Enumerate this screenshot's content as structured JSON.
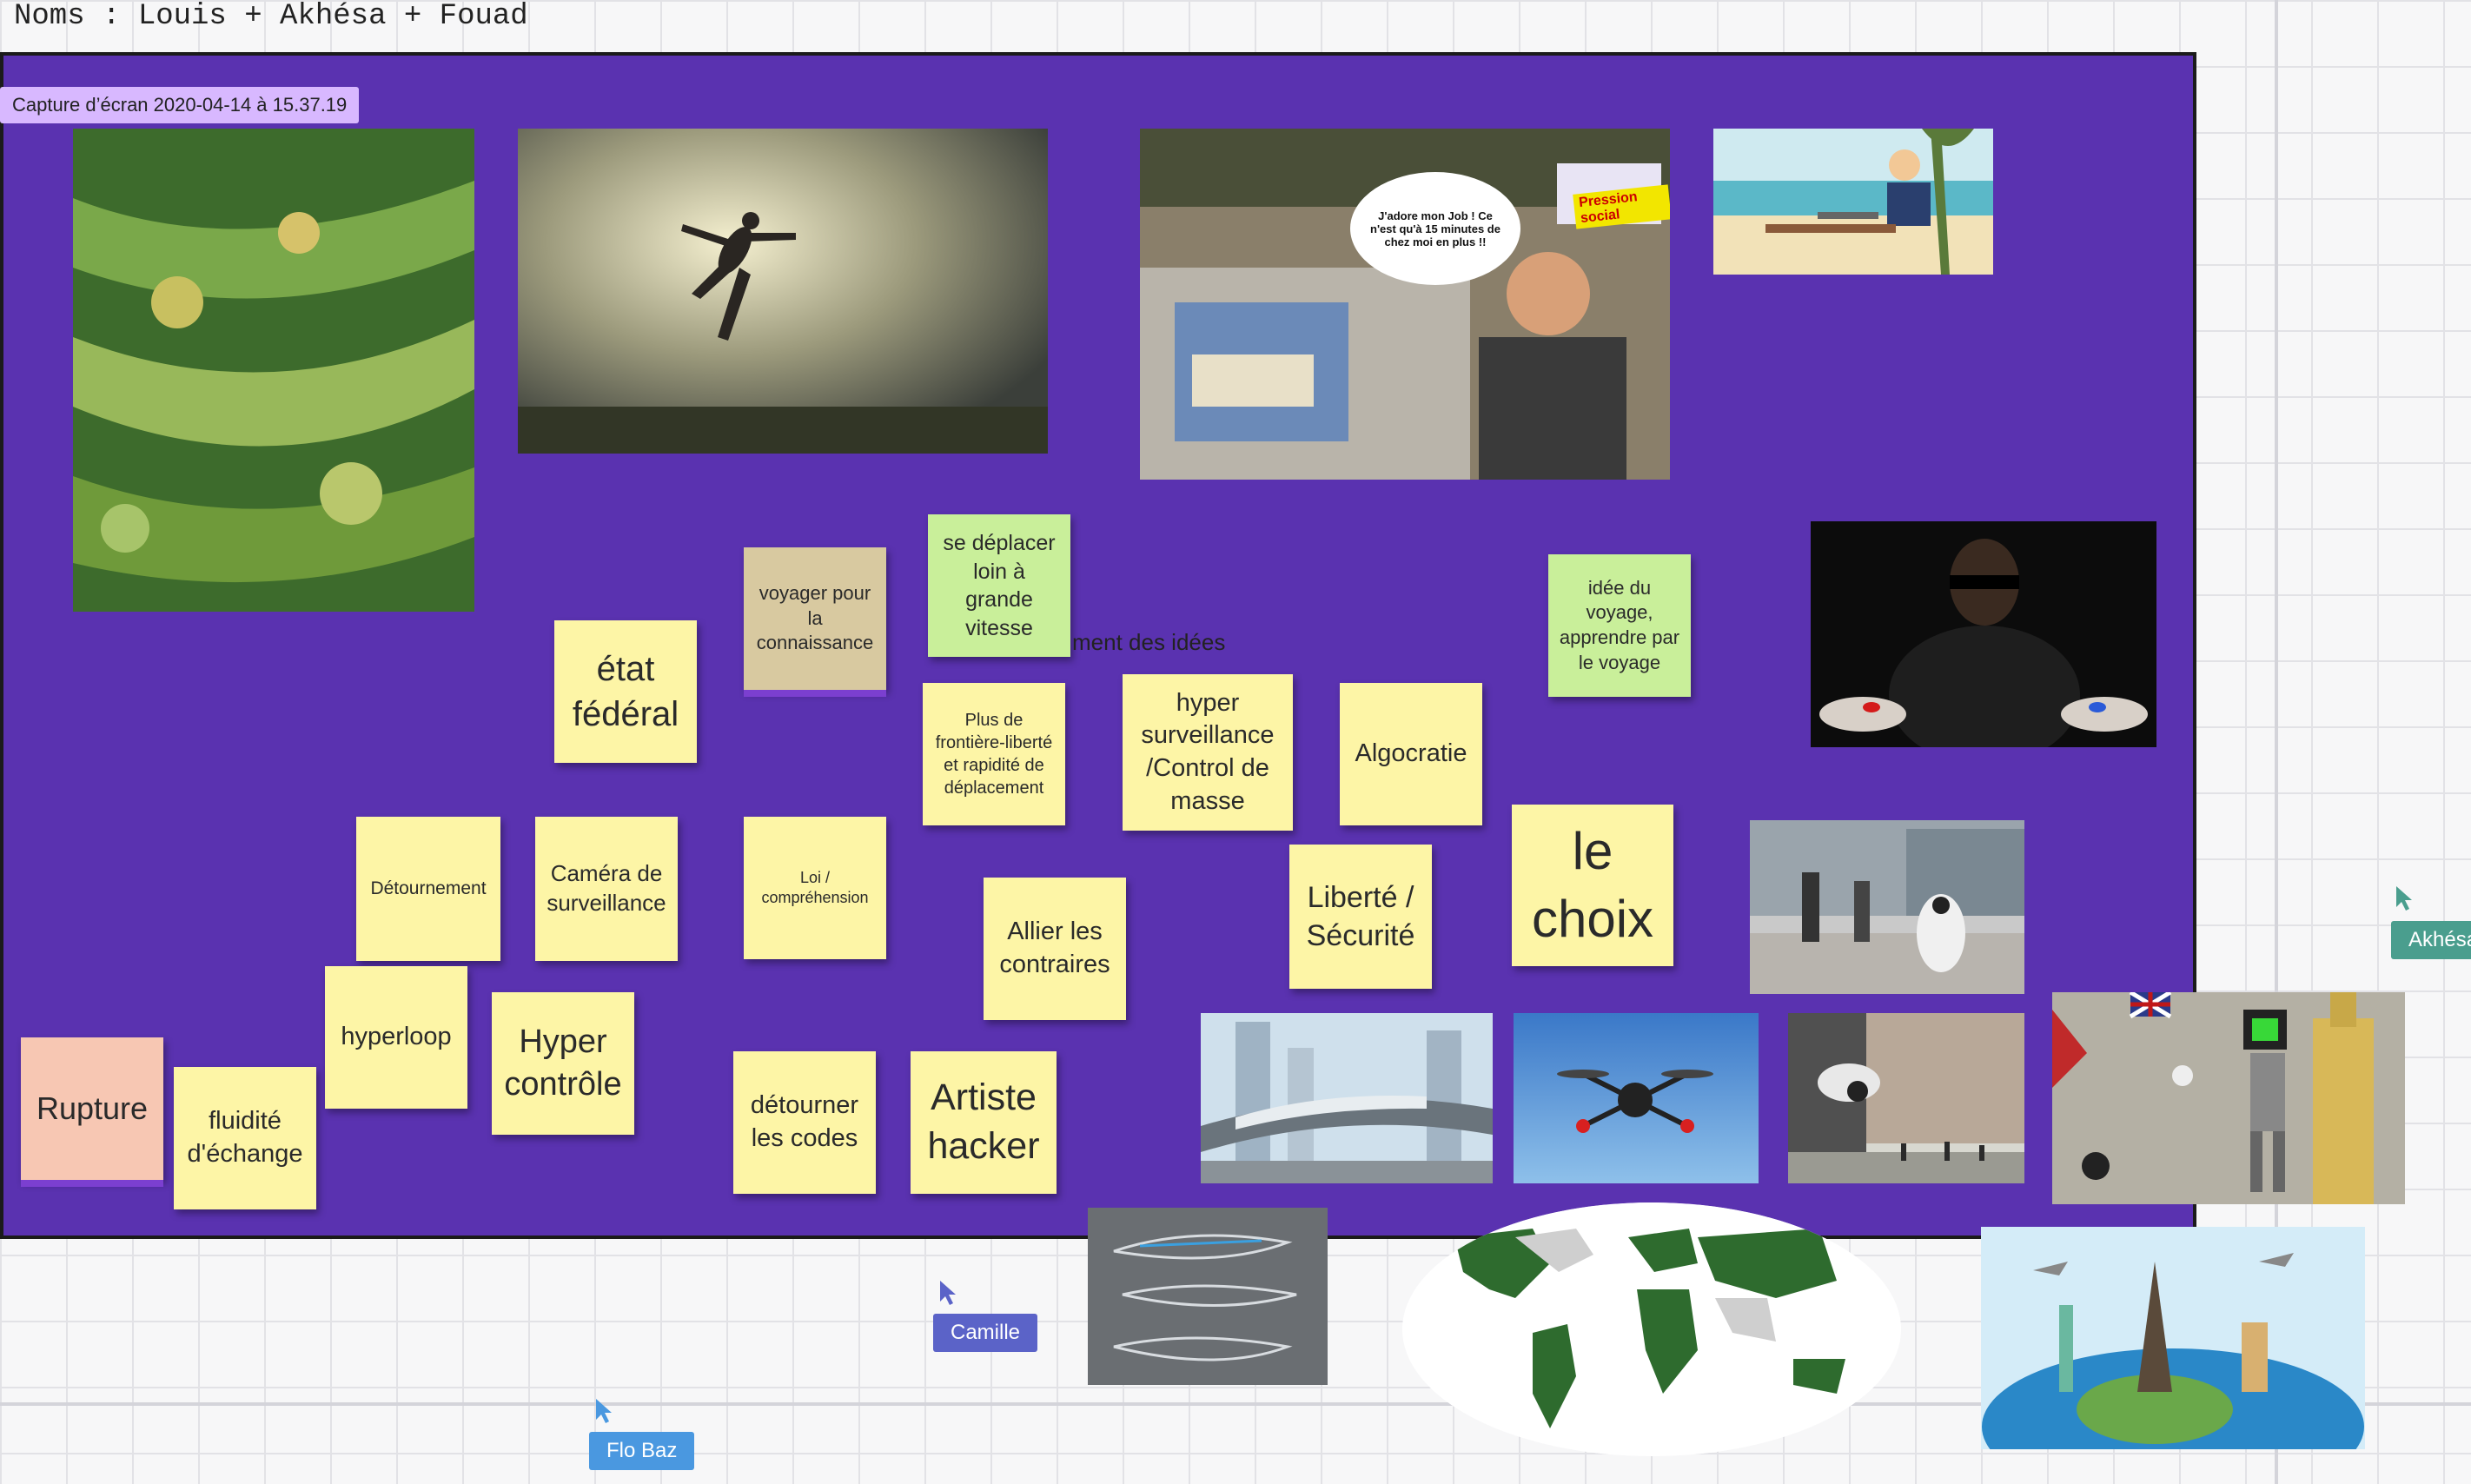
{
  "header": {
    "title": "Noms : Louis + Akhésa + Fouad"
  },
  "frame": {
    "label": "Capture d’écran 2020-04-14 à 15.37.19"
  },
  "notes": {
    "etat_federal": "état fédéral",
    "voyager": "voyager pour la connaissance",
    "se_deplacer": "se déplacer loin à grande vitesse",
    "free_text": "ment des idées",
    "plus_frontiere": "Plus de frontière-liberté et rapidité de déplacement",
    "hyper_surv": "hyper surveillance /Control de masse",
    "algocratie": "Algocratie",
    "idee_voyage": "idée du voyage, apprendre par le voyage",
    "detournement": "Détournement",
    "camera": "Caméra de surveillance",
    "loi": "Loi / compréhension",
    "allier": "Allier les contraires",
    "liberte": "Liberté / Sécurité",
    "le_choix": "le choix",
    "hyperloop": "hyperloop",
    "hyper_controle": "Hyper contrôle",
    "rupture": "Rupture",
    "fluidite": "fluidité d'échange",
    "detourner": "détourner les codes",
    "artiste": "Artiste hacker"
  },
  "comic": {
    "bubble": "J'adore mon Job ! Ce n'est qu'à 15 minutes de chez moi en plus !!",
    "tag": "Pression social"
  },
  "cursors": {
    "akhesa": "Akhésa",
    "camille": "Camille",
    "flobaz": "Flo Baz"
  },
  "colors": {
    "board": "#5a32b0",
    "sticky_yellow": "#fdf5a6",
    "sticky_green": "#c9ef9a",
    "cursor_akhesa": "#4a9e8e",
    "cursor_camille": "#5b63c8",
    "cursor_flo": "#4a98e0"
  },
  "images": [
    "vegetable-garden-photo",
    "woman-jumping-photo",
    "office-worker-comic",
    "beach-laptop-illustration",
    "matrix-pills-photo",
    "street-robot-photo",
    "maglev-train-photo",
    "drone-photo",
    "cctv-street-photo",
    "banksy-robot-art",
    "hyperloop-sketch",
    "world-map",
    "travel-globe-illustration"
  ]
}
